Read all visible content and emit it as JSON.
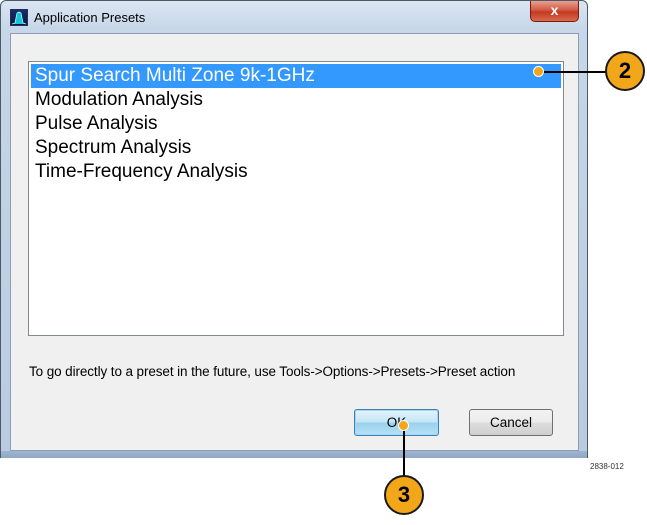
{
  "window": {
    "title": "Application Presets",
    "close_symbol": "x"
  },
  "presets": [
    {
      "label": "Spur Search Multi Zone 9k-1GHz",
      "selected": true
    },
    {
      "label": "Modulation Analysis",
      "selected": false
    },
    {
      "label": "Pulse Analysis",
      "selected": false
    },
    {
      "label": "Spectrum Analysis",
      "selected": false
    },
    {
      "label": "Time-Frequency Analysis",
      "selected": false
    }
  ],
  "hint": "To go directly to a preset in the future, use Tools->Options->Presets->Preset action",
  "buttons": {
    "ok": "OK",
    "cancel": "Cancel"
  },
  "callouts": {
    "list": "2",
    "ok": "3"
  },
  "figure_id": "2838-012",
  "colors": {
    "selection": "#3399ff",
    "callout": "#f2a71b"
  }
}
